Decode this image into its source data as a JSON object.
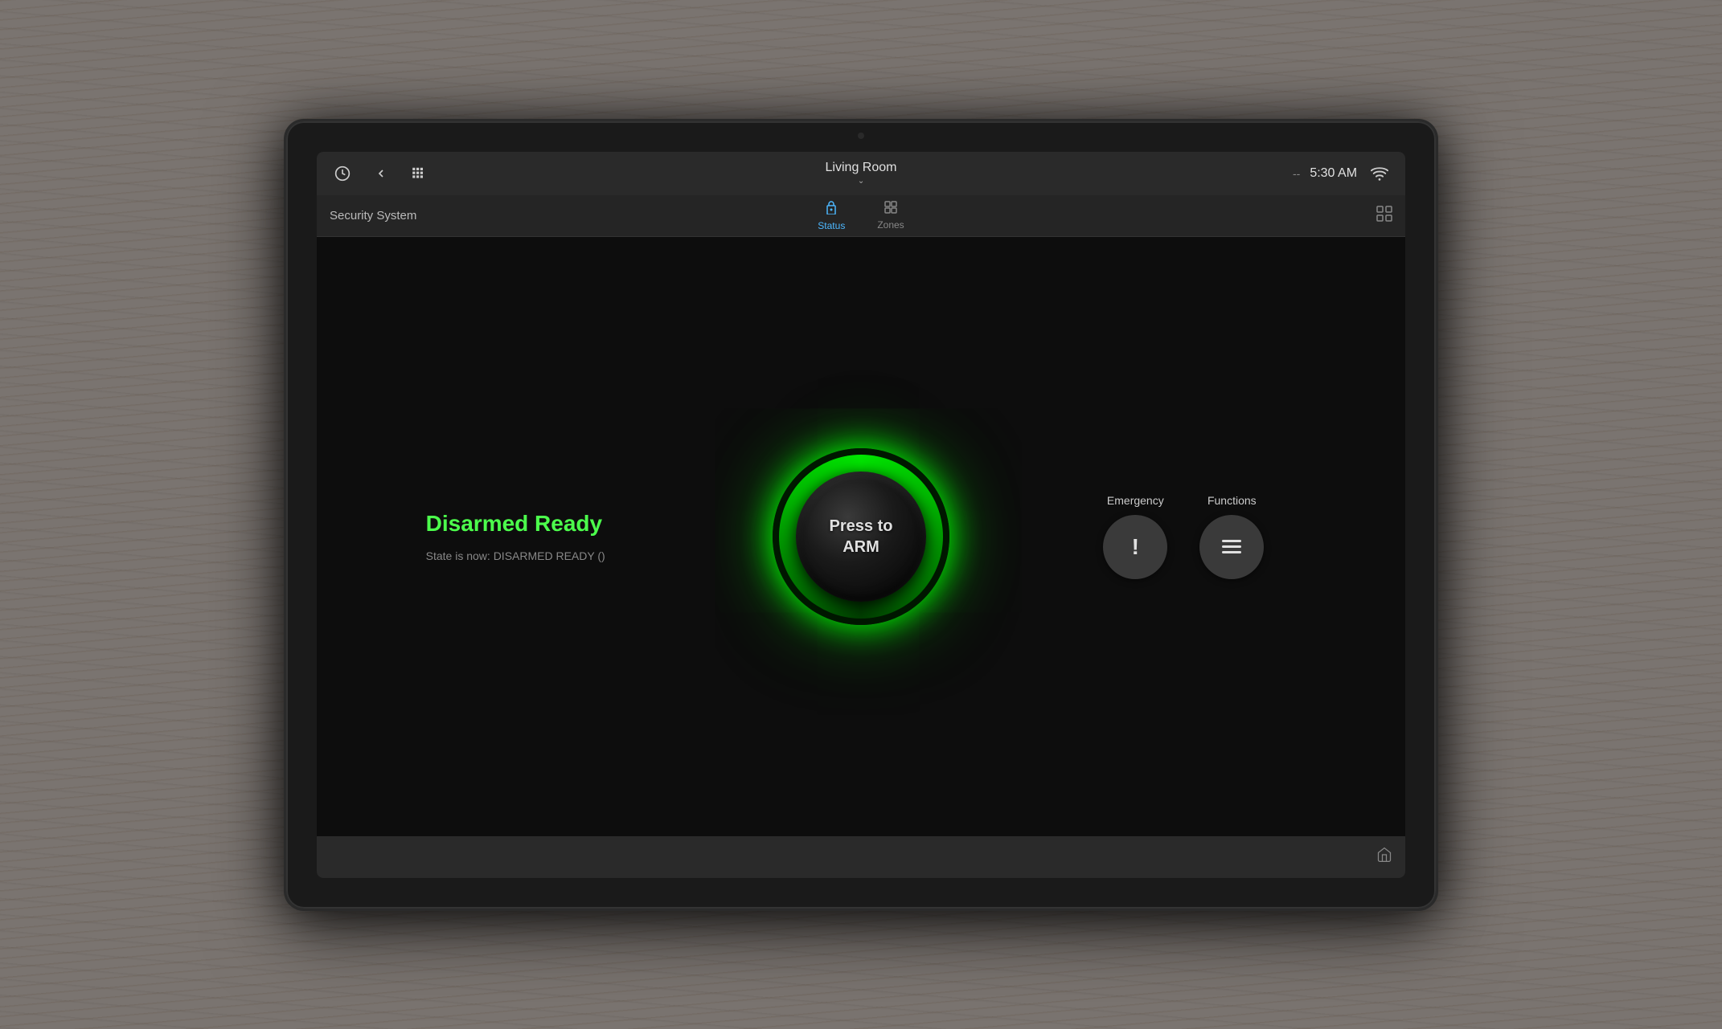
{
  "tablet": {
    "camera_label": "front camera"
  },
  "top_bar": {
    "back_icon": "◀",
    "nav_icon": "≡",
    "room_name": "Living Room",
    "chevron": "⌄",
    "dash": "--",
    "time": "5:30 AM",
    "wifi_icon": "wifi"
  },
  "nav_bar": {
    "section_name": "Security System",
    "tabs": [
      {
        "label": "Status",
        "icon": "🔒",
        "active": true
      },
      {
        "label": "Zones",
        "icon": "⊞",
        "active": false
      }
    ],
    "grid_icon": "⊞"
  },
  "main": {
    "status_label": "Disarmed Ready",
    "state_text": "State is now: DISARMED READY ()",
    "arm_button": {
      "line1": "Press to",
      "line2": "ARM"
    },
    "emergency": {
      "label": "Emergency",
      "icon": "!"
    },
    "functions": {
      "label": "Functions",
      "icon": "menu"
    }
  },
  "bottom_bar": {
    "home_icon": "home"
  },
  "colors": {
    "accent_green": "#4cff4c",
    "accent_blue": "#4db8ff",
    "glow_green": "#00ff00"
  }
}
